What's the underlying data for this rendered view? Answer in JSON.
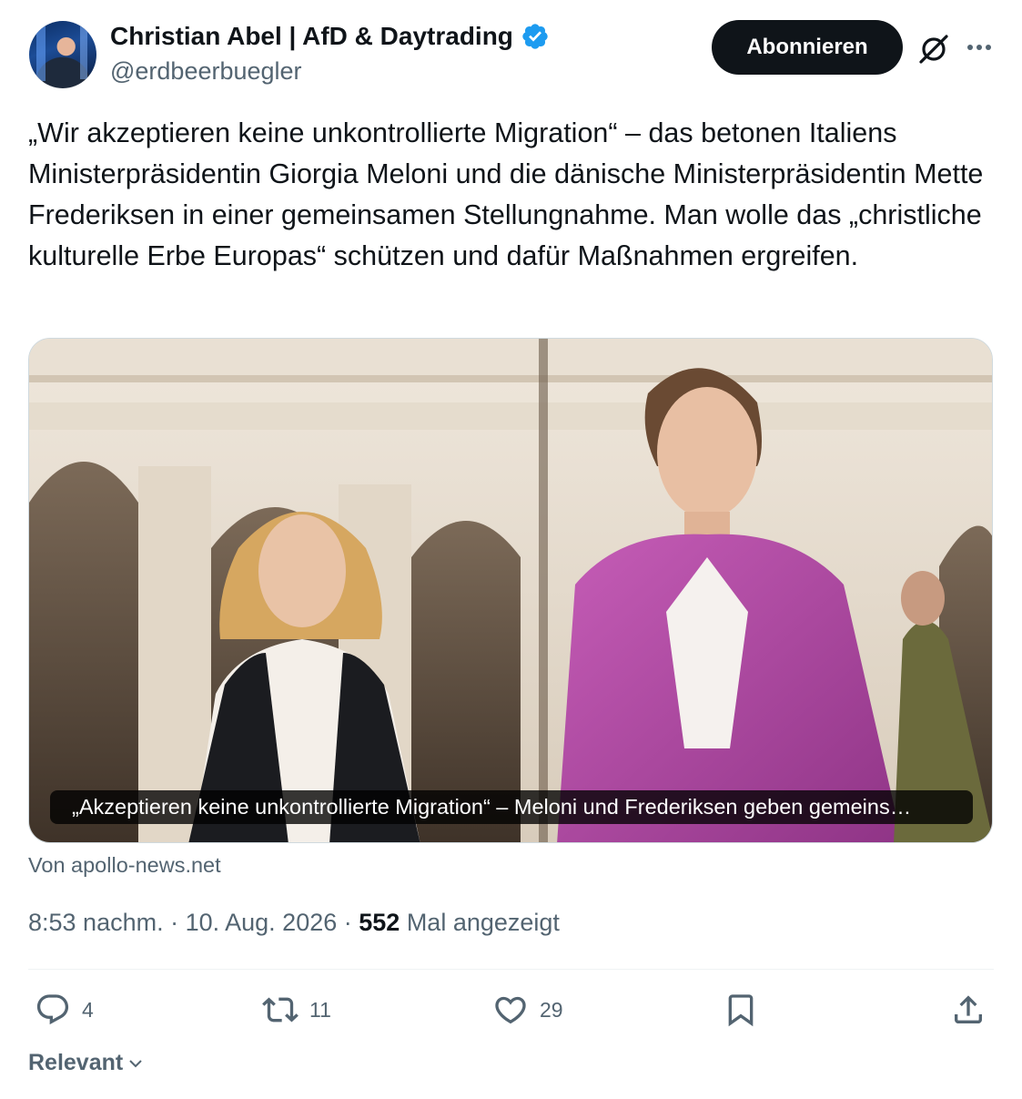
{
  "author": {
    "name": "Christian Abel | AfD & Daytrading",
    "handle": "@erdbeerbuegler",
    "avatar_icon": "avatar",
    "verified_icon": "verified-badge-icon",
    "verified_color": "#1d9bf0"
  },
  "header": {
    "follow_label": "Abonnieren",
    "grok_icon": "grok-icon",
    "more_icon": "more-options-icon"
  },
  "tweet": {
    "text": "„Wir akzeptieren keine unkontrollierte Migration“ – das betonen Italiens Ministerpräsidentin Giorgia Meloni und die dänische Ministerpräsidentin Mette Frederiksen in einer gemeinsamen Stellungnahme. Man wolle das „christliche kulturelle Erbe Europas“ schützen und dafür Maßnahmen ergreifen."
  },
  "card": {
    "caption": "„Akzeptieren keine unkontrollierte Migration“ – Meloni und Frederiksen geben gemeins…",
    "source": "Von apollo-news.net"
  },
  "meta": {
    "time": "8:53 nachm.",
    "separator": " · ",
    "date": "10. Aug. 2026",
    "views_count": "552",
    "views_label": " Mal angezeigt"
  },
  "actions": {
    "replies": "4",
    "reposts": "11",
    "likes": "29"
  },
  "sort": {
    "label": "Relevant"
  },
  "colors": {
    "text": "#0f1419",
    "secondary": "#536471",
    "accent": "#1d9bf0",
    "button_bg": "#0f1419"
  }
}
